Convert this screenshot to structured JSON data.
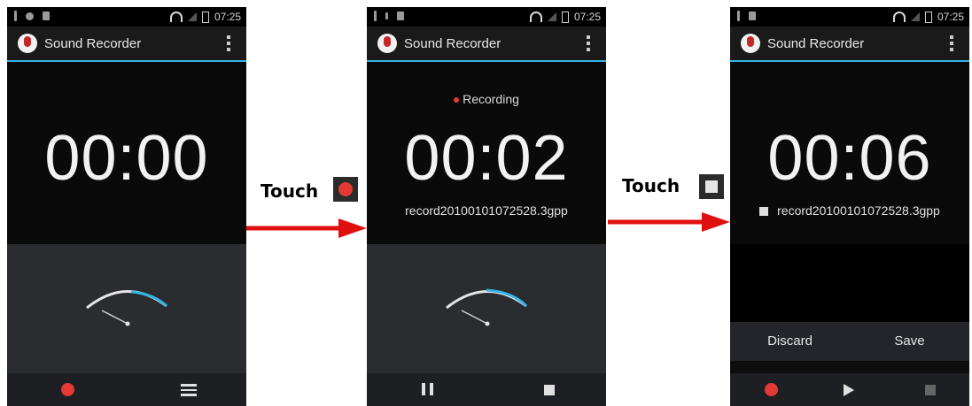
{
  "statusbar": {
    "time": "07:25"
  },
  "app": {
    "title": "Sound Recorder"
  },
  "screens": [
    {
      "timer": "00:00"
    },
    {
      "status": "Recording",
      "timer": "00:02",
      "filename": "record20100101072528.3gpp"
    },
    {
      "timer": "00:06",
      "filename": "record20100101072528.3gpp",
      "discard": "Discard",
      "save": "Save"
    }
  ],
  "annotations": {
    "touch_1": "Touch",
    "touch_2": "Touch"
  },
  "icons": [
    "app-microphone-icon",
    "overflow-menu-icon",
    "record-icon",
    "recordings-list-icon",
    "pause-icon",
    "stop-icon",
    "play-icon",
    "arrow-right-icon"
  ],
  "colors": {
    "accent": "#33b5e5",
    "record": "#e53935",
    "arrow": "#e01010"
  }
}
